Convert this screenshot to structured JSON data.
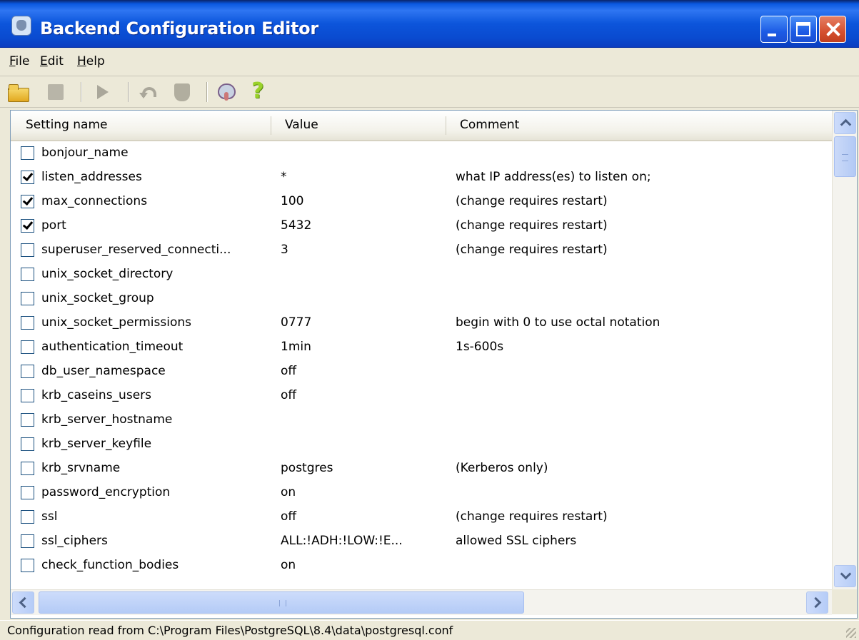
{
  "window": {
    "title": "Backend Configuration Editor",
    "icon": "pgadmin-elephant-icon",
    "controls": [
      "minimize-icon",
      "maximize-icon",
      "close-icon"
    ]
  },
  "menu": {
    "items": [
      {
        "label": "File"
      },
      {
        "label": "Edit"
      },
      {
        "label": "Help"
      }
    ]
  },
  "toolbar": {
    "icons": [
      "open-folder-icon",
      "save-icon",
      "execute-icon",
      "undo-icon",
      "stop-icon",
      "pgadmin-icon",
      "help-icon"
    ],
    "help_glyph": "?"
  },
  "list": {
    "columns": [
      {
        "label": "Setting name"
      },
      {
        "label": "Value"
      },
      {
        "label": "Comment"
      }
    ],
    "rows": [
      {
        "checked": false,
        "name": "bonjour_name",
        "value": "",
        "comment": ""
      },
      {
        "checked": true,
        "name": "listen_addresses",
        "value": "*",
        "comment": "what IP address(es) to listen on;"
      },
      {
        "checked": true,
        "name": "max_connections",
        "value": "100",
        "comment": "(change requires restart)"
      },
      {
        "checked": true,
        "name": "port",
        "value": "5432",
        "comment": "(change requires restart)"
      },
      {
        "checked": false,
        "name": "superuser_reserved_connecti...",
        "value": "3",
        "comment": "(change requires restart)"
      },
      {
        "checked": false,
        "name": "unix_socket_directory",
        "value": "",
        "comment": ""
      },
      {
        "checked": false,
        "name": "unix_socket_group",
        "value": "",
        "comment": ""
      },
      {
        "checked": false,
        "name": "unix_socket_permissions",
        "value": "0777",
        "comment": "begin with 0 to use octal notation"
      },
      {
        "checked": false,
        "name": "authentication_timeout",
        "value": "1min",
        "comment": "1s-600s"
      },
      {
        "checked": false,
        "name": "db_user_namespace",
        "value": "off",
        "comment": ""
      },
      {
        "checked": false,
        "name": "krb_caseins_users",
        "value": "off",
        "comment": ""
      },
      {
        "checked": false,
        "name": "krb_server_hostname",
        "value": "",
        "comment": ""
      },
      {
        "checked": false,
        "name": "krb_server_keyfile",
        "value": "",
        "comment": ""
      },
      {
        "checked": false,
        "name": "krb_srvname",
        "value": "postgres",
        "comment": "(Kerberos only)"
      },
      {
        "checked": false,
        "name": "password_encryption",
        "value": "on",
        "comment": ""
      },
      {
        "checked": false,
        "name": "ssl",
        "value": "off",
        "comment": "(change requires restart)"
      },
      {
        "checked": false,
        "name": "ssl_ciphers",
        "value": "ALL:!ADH:!LOW:!E...",
        "comment": "allowed SSL ciphers"
      },
      {
        "checked": false,
        "name": "check_function_bodies",
        "value": "on",
        "comment": ""
      }
    ]
  },
  "status": {
    "text": "Configuration read from C:\\Program Files\\PostgreSQL\\8.4\\data\\postgresql.conf"
  }
}
